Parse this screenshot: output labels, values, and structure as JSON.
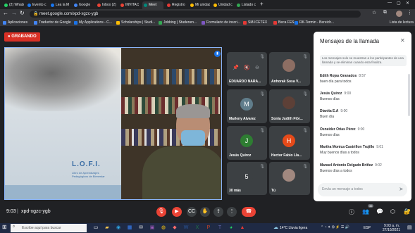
{
  "tabs": [
    {
      "label": "(2) Whats",
      "color": "#25d366"
    },
    {
      "label": "Evento c",
      "color": "#1877f2"
    },
    {
      "label": "Lea la M",
      "color": "#1877f2"
    },
    {
      "label": "Google",
      "color": "#4285f4"
    },
    {
      "label": "Inbox (2)",
      "color": "#ea4335"
    },
    {
      "label": "INVITAC",
      "color": "#ea4335"
    },
    {
      "label": "Meet",
      "color": "#00897b"
    },
    {
      "label": "Registro",
      "color": "#e53935"
    },
    {
      "label": "Mi unidad",
      "color": "#fbbc04"
    },
    {
      "label": "Unidad c",
      "color": "#fbbc04"
    },
    {
      "label": "Listado c",
      "color": "#34a853"
    }
  ],
  "address": {
    "url": "meet.google.com/xpd-xgzc-ygb"
  },
  "bookmarks": [
    {
      "label": "Aplicaciones",
      "color": "#4285f4"
    },
    {
      "label": "Traductor de Google",
      "color": "#4285f4"
    },
    {
      "label": "My Applications - C...",
      "color": "#1a73e8"
    },
    {
      "label": "Scholarships | Studi...",
      "color": "#fbbc04"
    },
    {
      "label": "Jobbing | Studenen...",
      "color": "#34a853"
    },
    {
      "label": "Formulario de inscri...",
      "color": "#7e57c2"
    },
    {
      "label": "SM-ICETEX",
      "color": "#e53935"
    },
    {
      "label": "Beca FES",
      "color": "#e53935"
    },
    {
      "label": "RK-Termin - Bereich...",
      "color": "#1a73e8"
    }
  ],
  "reading_list": "Lista de lectura",
  "recording": {
    "label": "GRABANDO"
  },
  "presenter": {
    "board_title": "L.O.F.I.",
    "board_subtitle": "Libro de Aprendizajes Pedagógicos de Bienestar"
  },
  "tiles": [
    {
      "name": "EDUARDO NARA...",
      "avatar": "",
      "bg": "#3c4043"
    },
    {
      "name": "Anhorak Sosa V...",
      "avatar": "photo",
      "bg": "#3c4043"
    },
    {
      "name": "Marleny Alvarez",
      "avatar": "M",
      "bg": "#607d8b"
    },
    {
      "name": "Sonia Judith Flór...",
      "avatar": "photo",
      "bg": "#3c4043"
    },
    {
      "name": "Jesús Quiroz",
      "avatar": "J",
      "bg": "#2e7d32"
    },
    {
      "name": "Hector Fabio Lla...",
      "avatar": "H",
      "bg": "#e64a19"
    },
    {
      "name": "30 más",
      "avatar": "5",
      "bg": "#3c4043"
    },
    {
      "name": "Tú",
      "avatar": "photo",
      "bg": "#3c4043"
    }
  ],
  "chat": {
    "title": "Mensajes de la llamada",
    "notice": "Los mensajes solo se muestran a los participantes de una llamada y se eliminan cuando esta finaliza.",
    "messages": [
      {
        "author": "Edith Rojas Granados",
        "time": "8:57",
        "text": "buen día para todos"
      },
      {
        "author": "Jesús Quiroz",
        "time": "9:00",
        "text": "Buenos días"
      },
      {
        "author": "Dianita E.A",
        "time": "9:00",
        "text": "Buen día"
      },
      {
        "author": "Osneider Orias Pérez",
        "time": "9:00",
        "text": "Buenos días"
      },
      {
        "author": "Martha Monica Castrillon Trujillo",
        "time": "9:01",
        "text": "Muy buenos días a todos"
      },
      {
        "author": "Manuel Antonio Delgado Briñez",
        "time": "9:02",
        "text": "Buenos días a todos"
      }
    ],
    "input_placeholder": "Envía un mensaje a todos"
  },
  "meeting": {
    "time": "9:03",
    "code": "xpd-xgzc-ygb",
    "participants_badge": "36"
  },
  "taskbar": {
    "search_placeholder": "Escribe aquí para buscar",
    "weather": "14°C  Lluvia ligera",
    "lang": "ESP",
    "clock_time": "9:03 a. m.",
    "clock_date": "27/10/2021"
  }
}
